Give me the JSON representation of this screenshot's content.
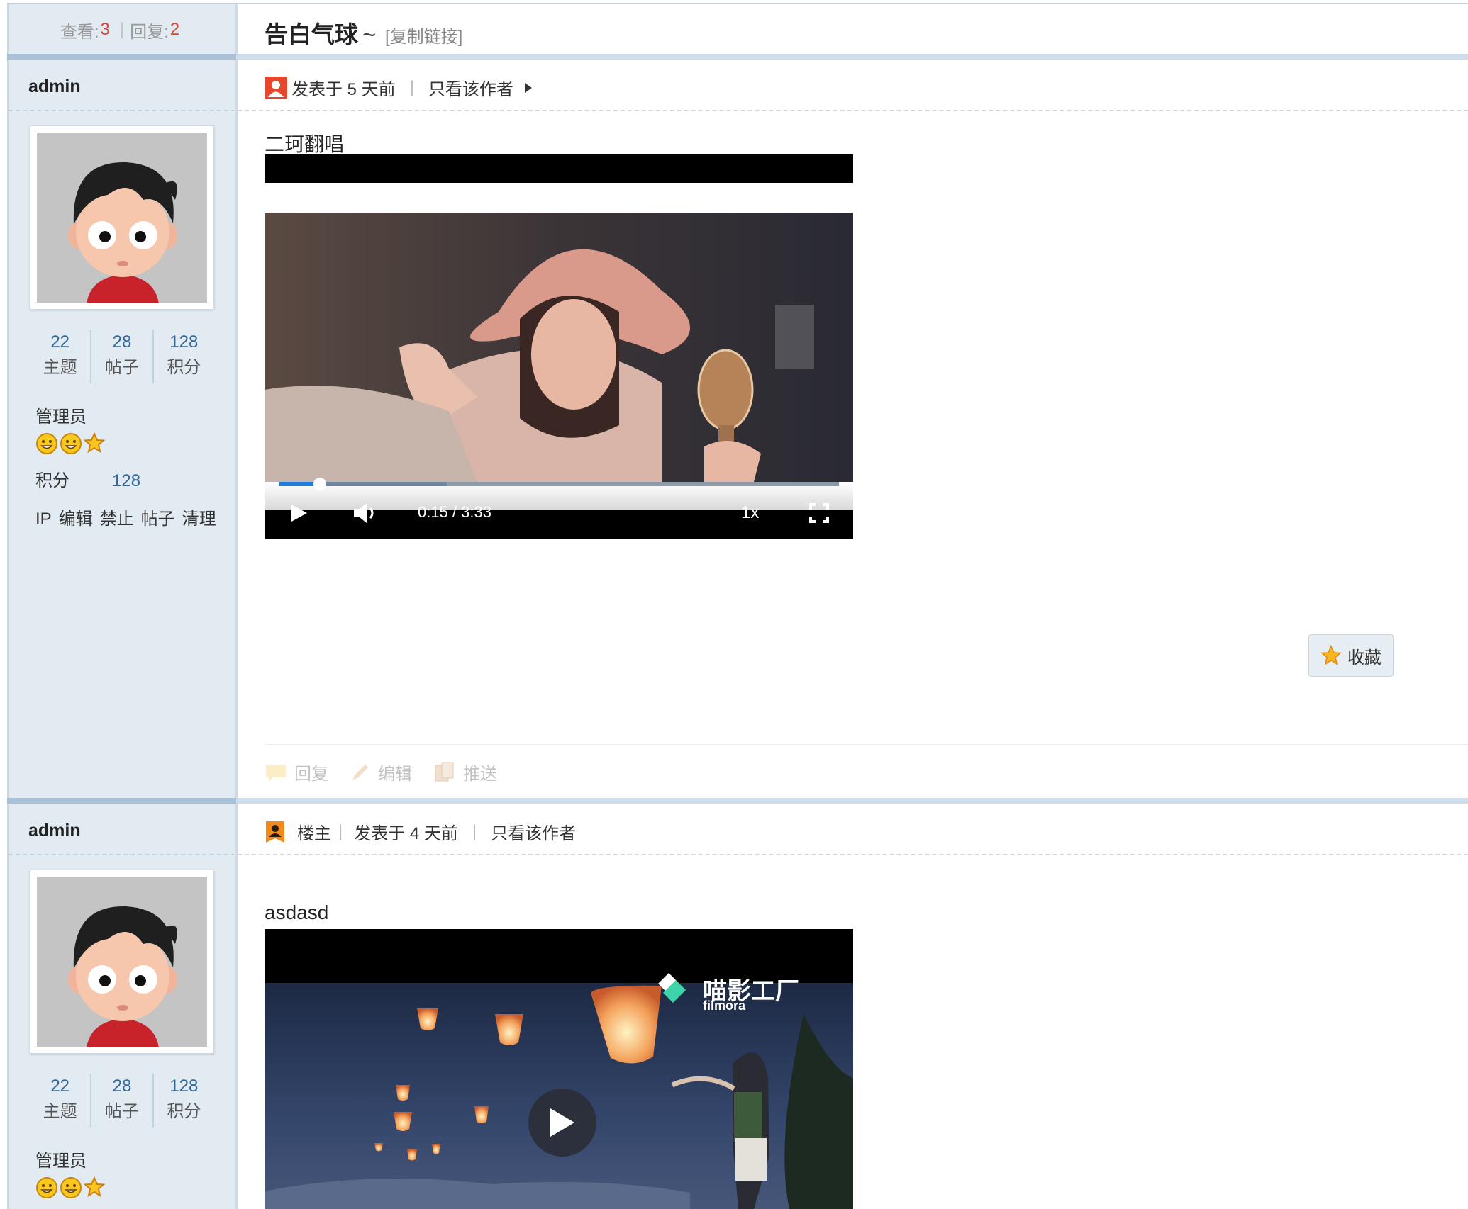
{
  "thread": {
    "views_label": "查看:",
    "views": "3",
    "sep": "|",
    "replies_label": "回复:",
    "replies": "2",
    "title": "告白气球",
    "title_tilde": "~",
    "copy_link": "[复制链接]"
  },
  "posts": [
    {
      "author": "admin",
      "stats": [
        {
          "value": "22",
          "label": "主题"
        },
        {
          "value": "28",
          "label": "帖子"
        },
        {
          "value": "128",
          "label": "积分"
        }
      ],
      "role": "管理员",
      "score_label": "积分",
      "score_value": "128",
      "admin_links": [
        "IP",
        "编辑",
        "禁止",
        "帖子",
        "清理"
      ],
      "posted": "发表于 5 天前",
      "only_author": "只看该作者",
      "text": "二珂翻唱",
      "video": {
        "time": "0:15 / 3:33",
        "speed": "1x",
        "progress": 0.07,
        "buffered": 0.3
      },
      "favorite": "收藏",
      "actions": [
        "回复",
        "编辑",
        "推送"
      ]
    },
    {
      "author": "admin",
      "stats": [
        {
          "value": "22",
          "label": "主题"
        },
        {
          "value": "28",
          "label": "帖子"
        },
        {
          "value": "128",
          "label": "积分"
        }
      ],
      "role": "管理员",
      "floor": "楼主",
      "posted": "发表于 4 天前",
      "only_author": "只看该作者",
      "text": "asdasd",
      "video": {
        "watermark_cn": "喵影工厂",
        "watermark_en": "filmora"
      }
    }
  ],
  "colors": {
    "sidebar": "#e2eaf2",
    "accent_number": "#e1422c",
    "link_blue": "#336699"
  }
}
